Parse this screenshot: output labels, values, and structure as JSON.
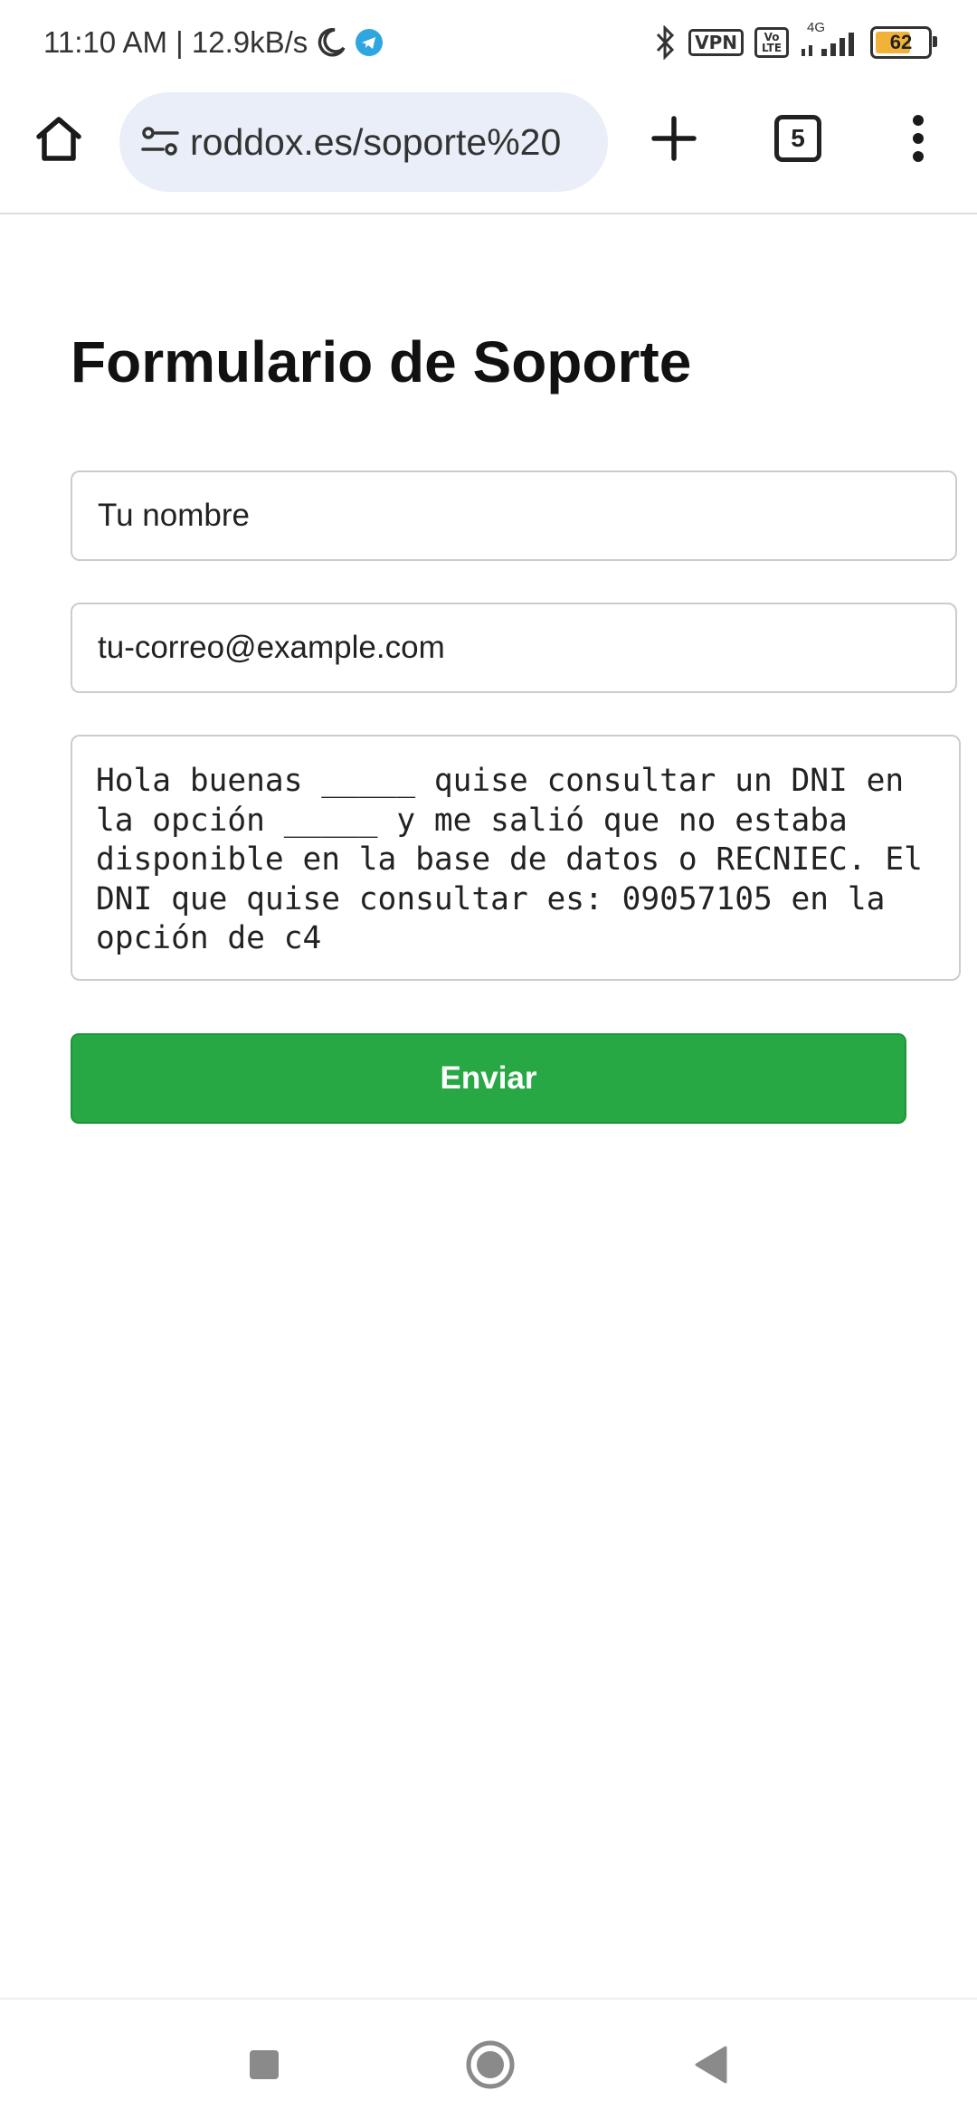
{
  "status_bar": {
    "time_and_speed": "11:10 AM | 12.9kB/s",
    "vpn_label": "VPN",
    "volte_label": "Vo LTE",
    "network_label": "4G",
    "battery_level": "62"
  },
  "browser": {
    "url": "roddox.es/soporte%20",
    "tab_count": "5"
  },
  "form": {
    "title": "Formulario de Soporte",
    "name_placeholder": "Tu nombre",
    "email_placeholder": "tu-correo@example.com",
    "message": "Hola buenas _____ quise consultar un DNI en la opción _____ y me salió que no estaba disponible en la base de datos o RECNIEC. El DNI que quise consultar es: 09057105 en la opción de c4",
    "submit_label": "Enviar"
  },
  "colors": {
    "submit_green": "#28a745",
    "urlbar_bg": "#e9eef8"
  }
}
